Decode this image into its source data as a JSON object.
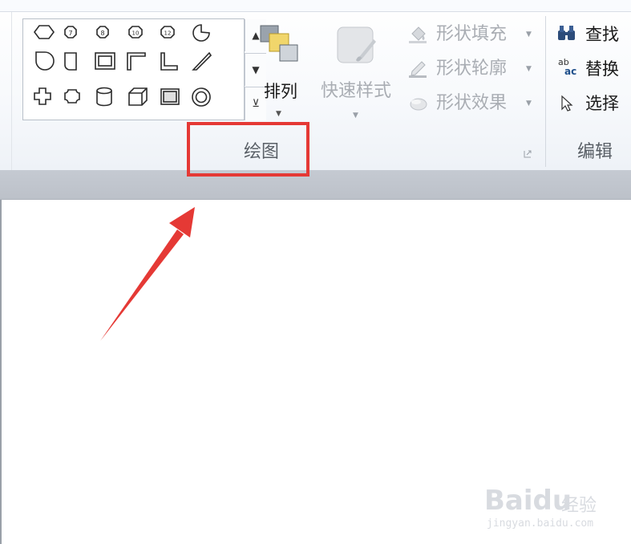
{
  "drawing_group": {
    "name": "绘图",
    "arrange": {
      "label": "排列"
    },
    "quick_styles": {
      "label": "快速样式"
    },
    "shape_fill": {
      "label": "形状填充"
    },
    "shape_outline": {
      "label": "形状轮廓"
    },
    "shape_effects": {
      "label": "形状效果"
    },
    "gallery_shapes": [
      [
        "hexagon",
        "octagon-7",
        "octagon-8",
        "octagon-10",
        "octagon-12",
        "pie"
      ],
      [
        "teardrop",
        "snip-corner",
        "frame",
        "half-frame",
        "l-shape",
        "diagonal-stripe"
      ],
      [
        "cross",
        "plaque",
        "can",
        "cube",
        "bevel",
        "donut"
      ]
    ],
    "gallery_numbers": {
      "n7": "7",
      "n8": "8",
      "n10": "10",
      "n12": "12"
    }
  },
  "editing_group": {
    "name": "编辑",
    "find": {
      "label": "查找"
    },
    "replace": {
      "label": "替换",
      "icon_text_top": "ab",
      "icon_text_bottom": "ac"
    },
    "select": {
      "label": "选择"
    }
  },
  "watermark": {
    "brand": "Baidu",
    "cn": "经验",
    "url": "jingyan.baidu.com"
  },
  "annotation": {
    "highlight_color": "#e53935",
    "arrow_color": "#e53935"
  }
}
